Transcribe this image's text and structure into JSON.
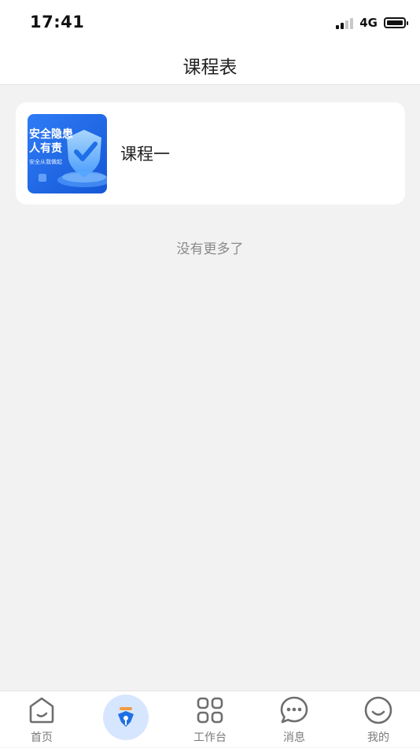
{
  "status": {
    "time": "17:41",
    "network": "4G"
  },
  "header": {
    "title": "课程表"
  },
  "courses": [
    {
      "title": "课程一",
      "thumb_text": {
        "line1": "安全隐患",
        "line2": "人有责",
        "line3": "安全从我做起"
      }
    }
  ],
  "list_end_text": "没有更多了",
  "tabs": [
    {
      "label": "首页",
      "icon": "home-icon"
    },
    {
      "label": "",
      "icon": "pen-icon"
    },
    {
      "label": "工作台",
      "icon": "grid-icon"
    },
    {
      "label": "消息",
      "icon": "chat-icon"
    },
    {
      "label": "我的",
      "icon": "smile-icon"
    }
  ],
  "colors": {
    "accent": "#3b82f6",
    "tab_highlight": "#d7e6ff"
  }
}
